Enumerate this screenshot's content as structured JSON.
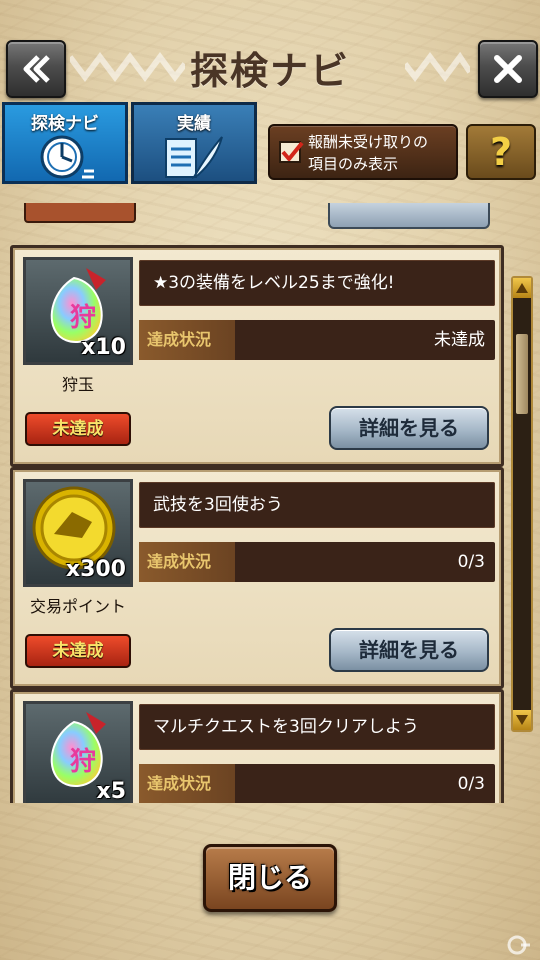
{
  "header": {
    "title": "探検ナビ",
    "back_icon": "double-chevron-left-icon",
    "close_icon": "x-close-icon"
  },
  "tabs": [
    {
      "label": "探検ナビ",
      "icon": "compass-clock-icon",
      "active": true
    },
    {
      "label": "実績",
      "icon": "scroll-feather-icon",
      "active": false
    }
  ],
  "filter": {
    "label_line1": "報酬未受け取りの",
    "label_line2": "項目のみ表示",
    "checked": true
  },
  "help": {
    "label": "?"
  },
  "missions": [
    {
      "reward_name": "狩玉",
      "reward_icon": "hunting-jewel-icon",
      "reward_qty": "x10",
      "status": "未達成",
      "title": "★3の装備をレベル25まで強化!",
      "progress_label": "達成状況",
      "progress_value": "未達成",
      "detail_label": "詳細を見る"
    },
    {
      "reward_name": "交易ポイント",
      "reward_icon": "gold-coin-icon",
      "reward_qty": "x300",
      "status": "未達成",
      "title": "武技を3回使おう",
      "progress_label": "達成状況",
      "progress_value": "0/3",
      "detail_label": "詳細を見る"
    },
    {
      "reward_name": "",
      "reward_icon": "hunting-jewel-icon",
      "reward_qty": "x5",
      "status": "",
      "title": "マルチクエストを3回クリアしよう",
      "progress_label": "達成状況",
      "progress_value": "0/3",
      "detail_label": ""
    }
  ],
  "footer": {
    "close_label": "閉じる"
  },
  "colors": {
    "parchment": "#efe3c4",
    "dark_bar": "#3a2318",
    "status_red": "#d23a1e",
    "tab_blue": "#1e82cf",
    "gold": "#f0c64a"
  }
}
